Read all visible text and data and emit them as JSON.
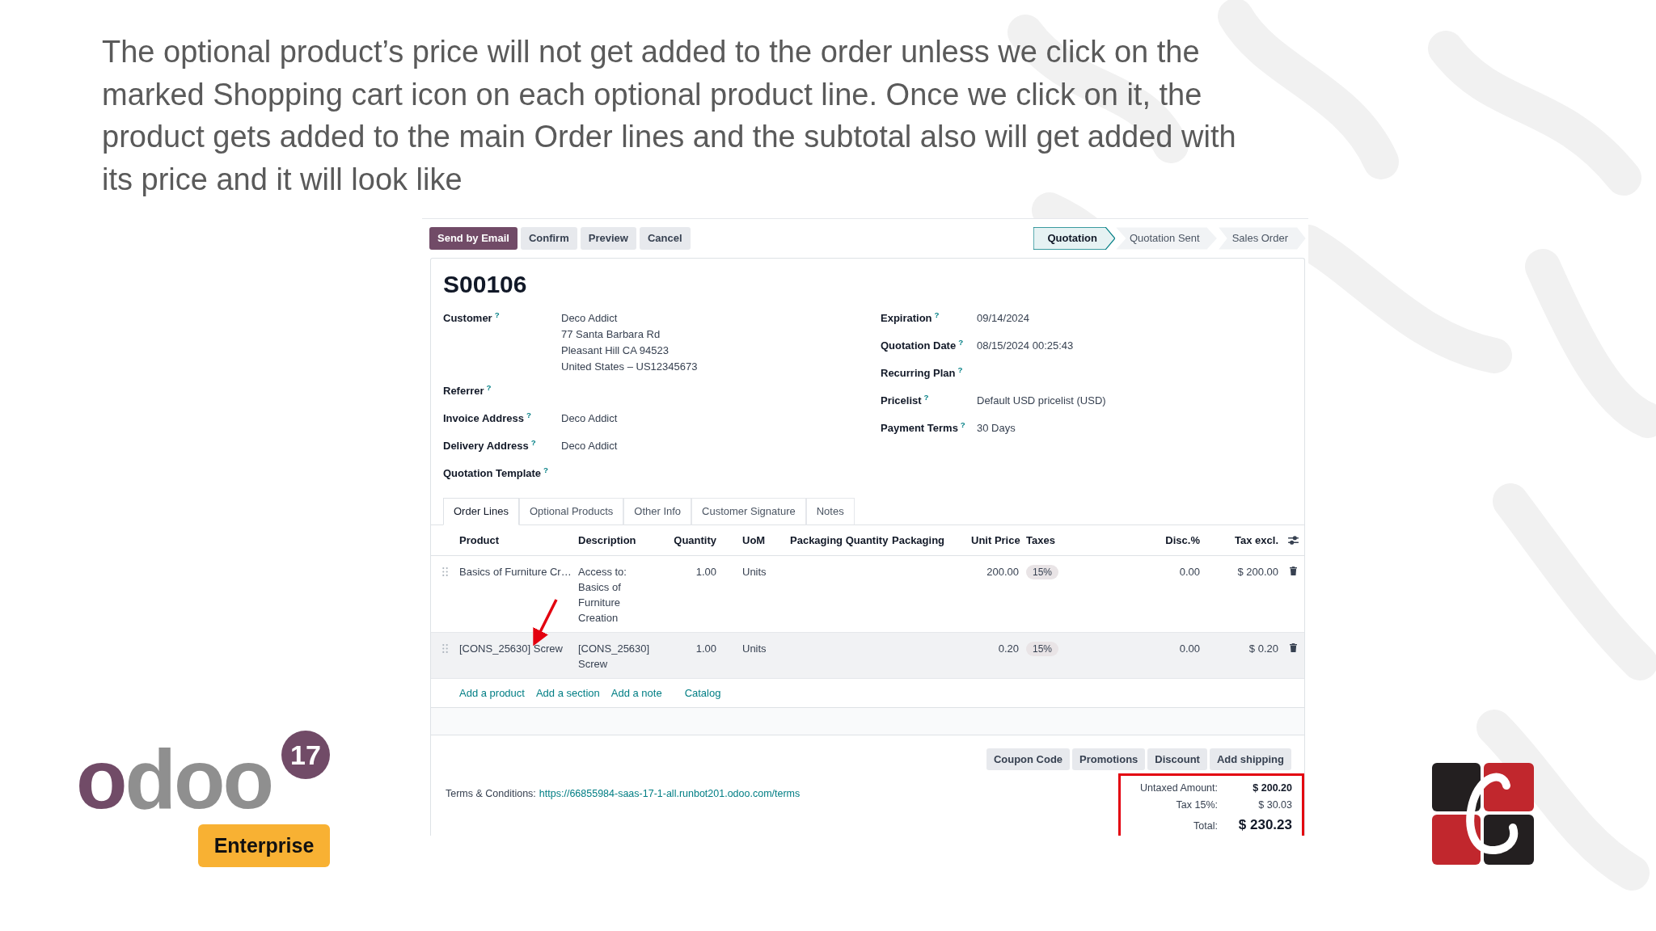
{
  "caption": "The optional product’s price will not get added to the order unless we click on the marked Shopping cart icon on each optional product line. Once we click on it, the product gets added to the main Order lines and the subtotal also will get added with its price and it will look like",
  "toolbar": [
    {
      "label": "Send by Email",
      "primary": true
    },
    {
      "label": "Confirm",
      "primary": false
    },
    {
      "label": "Preview",
      "primary": false
    },
    {
      "label": "Cancel",
      "primary": false
    }
  ],
  "status_steps": [
    {
      "label": "Quotation",
      "selected": true
    },
    {
      "label": "Quotation Sent",
      "selected": false
    },
    {
      "label": "Sales Order",
      "selected": false
    }
  ],
  "record_name": "S00106",
  "left_fields": [
    {
      "label": "Customer$^{?}$",
      "lines": [
        "Deco Addict",
        "77 Santa Barbara Rd",
        "Pleasant Hill CA 94523",
        "United States – US12345673"
      ]
    },
    {
      "label": "Referrer$^{?}$"
    },
    {
      "label": "Invoice Address$^{?}$",
      "lines": [
        "Deco Addict"
      ]
    },
    {
      "label": "Delivery Address$^{?}$",
      "lines": [
        "Deco Addict"
      ]
    },
    {
      "label": "Quotation Template$^{?}$"
    }
  ],
  "right_fields": [
    {
      "label": "Expiration$^{?}$",
      "lines": [
        "09/14/2024"
      ]
    },
    {
      "label": "Quotation Date$^{?}$",
      "lines": [
        "08/15/2024 00:25:43"
      ]
    },
    {
      "label": "Recurring Plan$^{?}$"
    },
    {
      "label": "Pricelist$^{?}$",
      "lines": [
        "Default USD pricelist (USD)"
      ]
    },
    {
      "label": "Payment Terms$^{?}$",
      "lines": [
        "30 Days"
      ]
    }
  ],
  "tabs": [
    {
      "label": "Order Lines",
      "selected": true
    },
    {
      "label": "Optional Products",
      "selected": false
    },
    {
      "label": "Other Info",
      "selected": false
    },
    {
      "label": "Customer Signature",
      "selected": false
    },
    {
      "label": "Notes",
      "selected": false
    }
  ],
  "table": {
    "columns": [
      "Product",
      "Description",
      "Quantity",
      "UoM",
      "Packaging Quantity",
      "Packaging",
      "Unit Price",
      "Taxes",
      "Disc.%",
      "Tax excl."
    ],
    "rows": [
      {
        "product": "Basics of Furniture Cr…",
        "description": "Access to: Basics of Furniture Creation",
        "quantity": "1.00",
        "uom": "Units",
        "unit_price": "200.00",
        "taxes": "15%",
        "discount": "0.00",
        "subtotal": "$ 200.00",
        "highlighted": false
      },
      {
        "product": "[CONS_25630] Screw",
        "description": "[CONS_25630] Screw",
        "quantity": "1.00",
        "uom": "Units",
        "unit_price": "0.20",
        "taxes": "15%",
        "discount": "0.00",
        "subtotal": "$ 0.20",
        "highlighted": true
      }
    ]
  },
  "add_links": [
    "Add a product",
    "Add a section",
    "Add a note",
    "Catalog"
  ],
  "promo_buttons": [
    "Coupon Code",
    "Promotions",
    "Discount",
    "Add shipping"
  ],
  "terms": {
    "label": "Terms & Conditions:",
    "link": "https://66855984-saas-17-1-all.runbot201.odoo.com/terms"
  },
  "totals": [
    {
      "label": "Untaxed Amount:",
      "value": "$ 200.20",
      "kind": "strong"
    },
    {
      "label": "Tax 15%:",
      "value": "$ 30.03",
      "kind": "plain"
    },
    {
      "label": "Total:",
      "value": "$ 230.23",
      "kind": "grand"
    }
  ],
  "brand": {
    "name": "odoo",
    "version": "17",
    "edition": "Enterprise"
  }
}
